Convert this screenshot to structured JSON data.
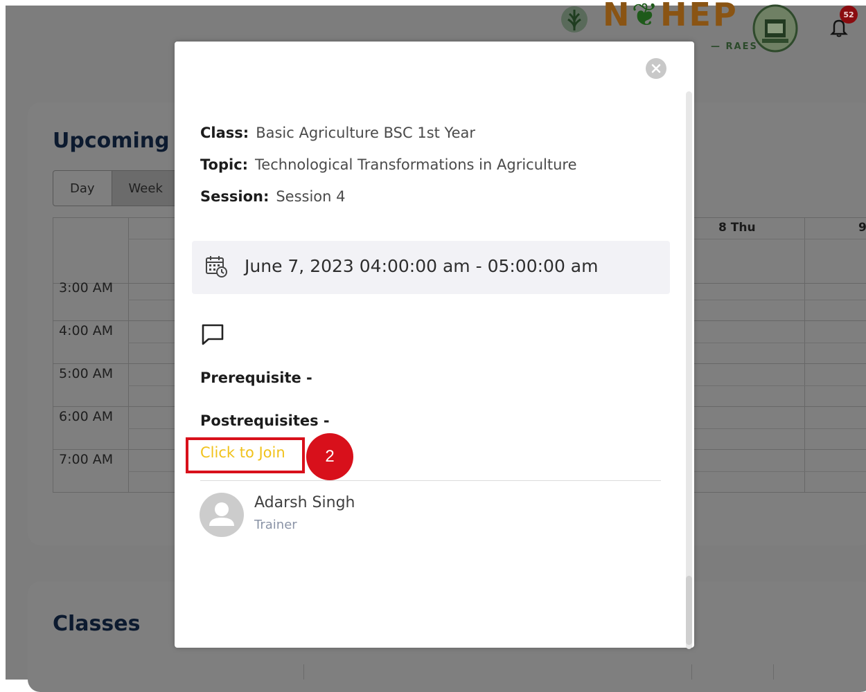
{
  "header": {
    "logo_text_part1": "N",
    "logo_text_part2": "HEP",
    "logo_sub": "RAES",
    "notification_count": "52"
  },
  "background": {
    "section_title": "Upcoming",
    "view_tabs": [
      {
        "label": "Day",
        "active": false
      },
      {
        "label": "Week",
        "active": true
      }
    ],
    "calendar": {
      "day_headers": [
        "8 Thu",
        "9"
      ],
      "time_slots": [
        "3:00 AM",
        "4:00 AM",
        "5:00 AM",
        "6:00 AM",
        "7:00 AM"
      ]
    },
    "classes_title": "Classes"
  },
  "modal": {
    "class_label": "Class:",
    "class_value": "Basic Agriculture BSC 1st Year",
    "topic_label": "Topic:",
    "topic_value": "Technological Transformations in Agriculture",
    "session_label": "Session:",
    "session_value": "Session 4",
    "datetime": "June 7, 2023 04:00:00 am - 05:00:00 am",
    "prerequisite_label": "Prerequisite -",
    "postrequisite_label": "Postrequisites -",
    "join_label": "Click to Join",
    "step_number": "2",
    "trainer": {
      "name": "Adarsh Singh",
      "role": "Trainer"
    }
  },
  "colors": {
    "join_link": "#f1c21b",
    "highlight": "#d8101b",
    "notification_badge": "#8a0c10",
    "overlay": "#7d7d7d"
  },
  "icons": [
    "wheat-emblem-icon",
    "institute-emblem-icon",
    "bell-icon",
    "close-icon",
    "calendar-clock-icon",
    "comment-icon",
    "user-avatar-icon"
  ]
}
